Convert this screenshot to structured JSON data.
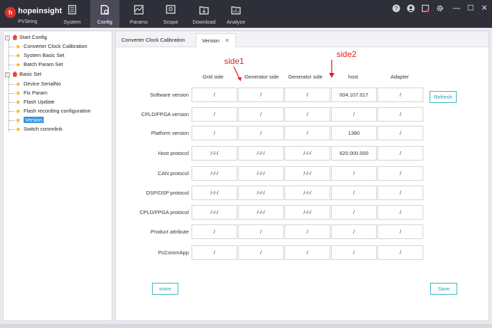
{
  "brand": {
    "name": "hopeinsight",
    "product": "PVString",
    "logo_letter": "h"
  },
  "nav": [
    {
      "label": "System",
      "icon": "system-icon",
      "active": false
    },
    {
      "label": "Config",
      "icon": "config-icon",
      "active": true
    },
    {
      "label": "Params",
      "icon": "params-icon",
      "active": false
    },
    {
      "label": "Scope",
      "icon": "scope-icon",
      "active": false
    },
    {
      "label": "Download",
      "icon": "download-icon",
      "active": false
    },
    {
      "label": "Analyze",
      "icon": "analyze-icon",
      "active": false
    }
  ],
  "window": {
    "help": "?",
    "minimize": "—",
    "maximize": "☐",
    "close": "✕"
  },
  "tree": {
    "groups": [
      {
        "label": "Start Config",
        "items": [
          "Converter Clock Calibration",
          "System Basic Set",
          "Batch Param Set"
        ]
      },
      {
        "label": "Basic Set",
        "items": [
          "Device SerialNo",
          "Fix Param",
          "Flash Update",
          "Flash recording configuration",
          "Version",
          "Switch commlink"
        ]
      }
    ],
    "expander": "−",
    "selected": "Version"
  },
  "tabs": [
    {
      "label": "Converter Clock Calibration",
      "active": false
    },
    {
      "label": "Version",
      "active": true,
      "close": "✕"
    }
  ],
  "annotations": {
    "side1": "side1",
    "side2": "side2"
  },
  "columns": [
    "Grid side",
    "Generator side",
    "Generator side",
    "host",
    "Adapter"
  ],
  "rows": [
    {
      "label": "Software version",
      "values": [
        "/",
        "/",
        "/",
        "004.107.017",
        "/"
      ]
    },
    {
      "label": "CPLD/FPGA version",
      "values": [
        "/",
        "/",
        "/",
        "/",
        "/"
      ]
    },
    {
      "label": "Platform version",
      "values": [
        "/",
        "/",
        "/",
        "1380",
        "/"
      ]
    },
    {
      "label": "Host protocol",
      "values": [
        "/-/-/",
        "/-/-/",
        "/-/-/",
        "620.000.000",
        "/"
      ]
    },
    {
      "label": "CAN protocol",
      "values": [
        "/-/-/",
        "/-/-/",
        "/-/-/",
        "/",
        "/"
      ]
    },
    {
      "label": "DSP/DSP protocol",
      "values": [
        "/-/-/",
        "/-/-/",
        "/-/-/",
        "/",
        "/"
      ]
    },
    {
      "label": "CPLD/FPGA protocol",
      "values": [
        "/-/-/",
        "/-/-/",
        "/-/-/",
        "/",
        "/"
      ]
    },
    {
      "label": "Product attribute",
      "values": [
        "/",
        "/",
        "/",
        "/",
        "/"
      ]
    },
    {
      "label": "PcCommApp",
      "values": [
        "/",
        "/",
        "/",
        "/",
        "/"
      ]
    }
  ],
  "buttons": {
    "refresh": "Refresh",
    "more": "more",
    "save": "Save"
  },
  "colors": {
    "accent": "#39b3c7",
    "topbar": "#2f2f3a",
    "selected": "#3a8fdb",
    "annotation": "#e02020",
    "star": "#f2b01e"
  }
}
